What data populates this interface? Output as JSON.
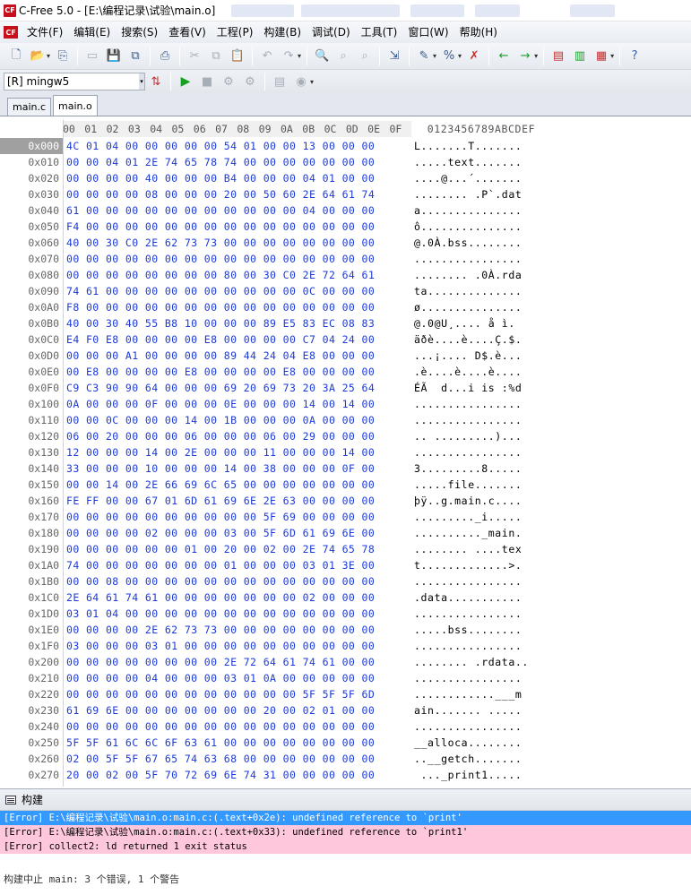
{
  "window": {
    "title": "C-Free 5.0 - [E:\\编程记录\\试验\\main.o]"
  },
  "menu": [
    "文件(F)",
    "编辑(E)",
    "搜索(S)",
    "查看(V)",
    "工程(P)",
    "构建(B)",
    "调试(D)",
    "工具(T)",
    "窗口(W)",
    "帮助(H)"
  ],
  "compiler": {
    "selected": "[R] mingw5"
  },
  "tabs": [
    {
      "label": "main.c"
    },
    {
      "label": "main.o"
    }
  ],
  "hex": {
    "header_cols": [
      "00",
      "01",
      "02",
      "03",
      "04",
      "05",
      "06",
      "07",
      "08",
      "09",
      "0A",
      "0B",
      "0C",
      "0D",
      "0E",
      "0F"
    ],
    "ascii_header": "0123456789ABCDEF",
    "rows": [
      {
        "offset": "0x000",
        "bytes": "4C 01 04 00 00 00 00 00 54 01 00 00 13 00 00 00",
        "ascii": "L.......T......."
      },
      {
        "offset": "0x010",
        "bytes": "00 00 04 01 2E 74 65 78 74 00 00 00 00 00 00 00",
        "ascii": ".....text......."
      },
      {
        "offset": "0x020",
        "bytes": "00 00 00 00 40 00 00 00 B4 00 00 00 04 01 00 00",
        "ascii": "....@...´......."
      },
      {
        "offset": "0x030",
        "bytes": "00 00 00 00 08 00 00 00 20 00 50 60 2E 64 61 74",
        "ascii": "........ .P`.dat"
      },
      {
        "offset": "0x040",
        "bytes": "61 00 00 00 00 00 00 00 00 00 00 00 04 00 00 00",
        "ascii": "a..............."
      },
      {
        "offset": "0x050",
        "bytes": "F4 00 00 00 00 00 00 00 00 00 00 00 00 00 00 00",
        "ascii": "ô..............."
      },
      {
        "offset": "0x060",
        "bytes": "40 00 30 C0 2E 62 73 73 00 00 00 00 00 00 00 00",
        "ascii": "@.0À.bss........"
      },
      {
        "offset": "0x070",
        "bytes": "00 00 00 00 00 00 00 00 00 00 00 00 00 00 00 00",
        "ascii": "................"
      },
      {
        "offset": "0x080",
        "bytes": "00 00 00 00 00 00 00 00 80 00 30 C0 2E 72 64 61",
        "ascii": "........ .0À.rda"
      },
      {
        "offset": "0x090",
        "bytes": "74 61 00 00 00 00 00 00 00 00 00 00 0C 00 00 00",
        "ascii": "ta.............."
      },
      {
        "offset": "0x0A0",
        "bytes": "F8 00 00 00 00 00 00 00 00 00 00 00 00 00 00 00",
        "ascii": "ø..............."
      },
      {
        "offset": "0x0B0",
        "bytes": "40 00 30 40 55 B8 10 00 00 00 89 E5 83 EC 08 83",
        "ascii": "@.0@U¸.... å ì. "
      },
      {
        "offset": "0x0C0",
        "bytes": "E4 F0 E8 00 00 00 00 E8 00 00 00 00 C7 04 24 00",
        "ascii": "äðè....è....Ç.$."
      },
      {
        "offset": "0x0D0",
        "bytes": "00 00 00 A1 00 00 00 00 89 44 24 04 E8 00 00 00",
        "ascii": "...¡.... D$.è..."
      },
      {
        "offset": "0x0E0",
        "bytes": "00 E8 00 00 00 00 E8 00 00 00 00 E8 00 00 00 00",
        "ascii": ".è....è....è...."
      },
      {
        "offset": "0x0F0",
        "bytes": "C9 C3 90 90 64 00 00 00 69 20 69 73 20 3A 25 64",
        "ascii": "ÉÃ  d...i is :%d"
      },
      {
        "offset": "0x100",
        "bytes": "0A 00 00 00 0F 00 00 00 0E 00 00 00 14 00 14 00",
        "ascii": "................"
      },
      {
        "offset": "0x110",
        "bytes": "00 00 0C 00 00 00 14 00 1B 00 00 00 0A 00 00 00",
        "ascii": "................"
      },
      {
        "offset": "0x120",
        "bytes": "06 00 20 00 00 00 06 00 00 00 06 00 29 00 00 00",
        "ascii": ".. .........)..."
      },
      {
        "offset": "0x130",
        "bytes": "12 00 00 00 14 00 2E 00 00 00 11 00 00 00 14 00",
        "ascii": "................"
      },
      {
        "offset": "0x140",
        "bytes": "33 00 00 00 10 00 00 00 14 00 38 00 00 00 0F 00",
        "ascii": "3.........8....."
      },
      {
        "offset": "0x150",
        "bytes": "00 00 14 00 2E 66 69 6C 65 00 00 00 00 00 00 00",
        "ascii": ".....file......."
      },
      {
        "offset": "0x160",
        "bytes": "FE FF 00 00 67 01 6D 61 69 6E 2E 63 00 00 00 00",
        "ascii": "þÿ..g.main.c...."
      },
      {
        "offset": "0x170",
        "bytes": "00 00 00 00 00 00 00 00 00 00 5F 69 00 00 00 00",
        "ascii": "........._i....."
      },
      {
        "offset": "0x180",
        "bytes": "00 00 00 00 02 00 00 00 03 00 5F 6D 61 69 6E 00",
        "ascii": ".........._main."
      },
      {
        "offset": "0x190",
        "bytes": "00 00 00 00 00 00 01 00 20 00 02 00 2E 74 65 78",
        "ascii": "........ ....tex"
      },
      {
        "offset": "0x1A0",
        "bytes": "74 00 00 00 00 00 00 00 01 00 00 00 03 01 3E 00",
        "ascii": "t.............>."
      },
      {
        "offset": "0x1B0",
        "bytes": "00 00 08 00 00 00 00 00 00 00 00 00 00 00 00 00",
        "ascii": "................"
      },
      {
        "offset": "0x1C0",
        "bytes": "2E 64 61 74 61 00 00 00 00 00 00 00 02 00 00 00",
        "ascii": ".data..........."
      },
      {
        "offset": "0x1D0",
        "bytes": "03 01 04 00 00 00 00 00 00 00 00 00 00 00 00 00",
        "ascii": "................"
      },
      {
        "offset": "0x1E0",
        "bytes": "00 00 00 00 2E 62 73 73 00 00 00 00 00 00 00 00",
        "ascii": ".....bss........"
      },
      {
        "offset": "0x1F0",
        "bytes": "03 00 00 00 03 01 00 00 00 00 00 00 00 00 00 00",
        "ascii": "................"
      },
      {
        "offset": "0x200",
        "bytes": "00 00 00 00 00 00 00 00 2E 72 64 61 74 61 00 00",
        "ascii": "........ .rdata.."
      },
      {
        "offset": "0x210",
        "bytes": "00 00 00 00 04 00 00 00 03 01 0A 00 00 00 00 00",
        "ascii": "................"
      },
      {
        "offset": "0x220",
        "bytes": "00 00 00 00 00 00 00 00 00 00 00 00 5F 5F 5F 6D",
        "ascii": "............___m"
      },
      {
        "offset": "0x230",
        "bytes": "61 69 6E 00 00 00 00 00 00 00 20 00 02 01 00 00",
        "ascii": "ain....... ....."
      },
      {
        "offset": "0x240",
        "bytes": "00 00 00 00 00 00 00 00 00 00 00 00 00 00 00 00",
        "ascii": "................"
      },
      {
        "offset": "0x250",
        "bytes": "5F 5F 61 6C 6C 6F 63 61 00 00 00 00 00 00 00 00",
        "ascii": "__alloca........"
      },
      {
        "offset": "0x260",
        "bytes": "02 00 5F 5F 67 65 74 63 68 00 00 00 00 00 00 00",
        "ascii": "..__getch......."
      },
      {
        "offset": "0x270",
        "bytes": "20 00 02 00 5F 70 72 69 6E 74 31 00 00 00 00 00",
        "ascii": " ..._print1....."
      }
    ]
  },
  "build": {
    "title": "构建",
    "messages": [
      "[Error] E:\\编程记录\\试验\\main.o:main.c:(.text+0x2e): undefined reference to `print'",
      "[Error] E:\\编程记录\\试验\\main.o:main.c:(.text+0x33): undefined reference to `print1'",
      "[Error] collect2: ld returned 1 exit status"
    ],
    "summary": "构建中止 main: 3 个错误, 1 个警告"
  }
}
